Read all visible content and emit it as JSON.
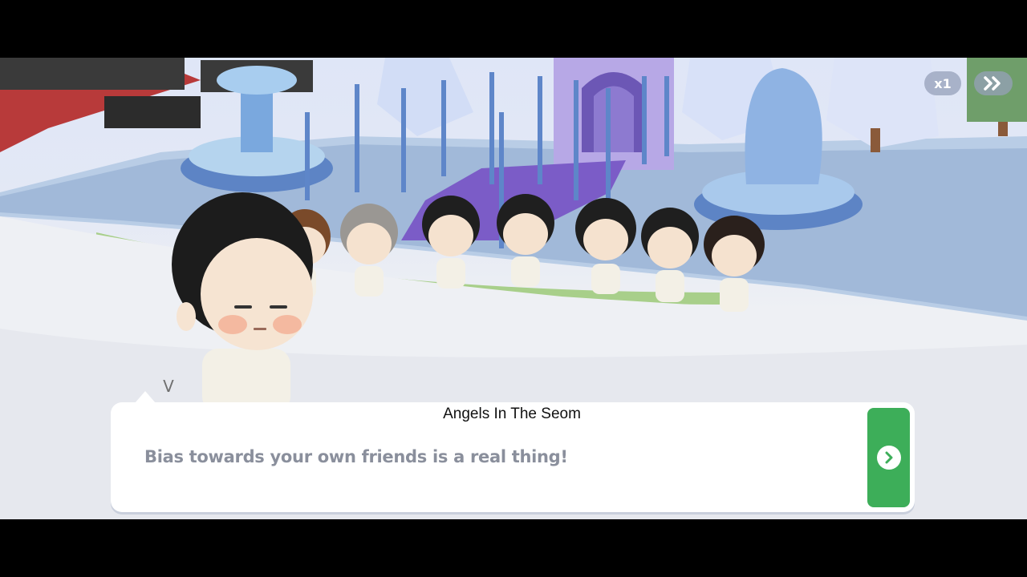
{
  "controls": {
    "speed_label": "x1",
    "skip_icon": "fast-forward-icon",
    "next_icon": "chevron-right-icon"
  },
  "dialog": {
    "speaker": "V",
    "title": "Angels In The Seom",
    "text": "Bias towards your own friends is a real thing!"
  },
  "colors": {
    "next_button": "#3dae59",
    "dialog_text": "#8a8f9c",
    "controls_bg": "#9aa0b9"
  }
}
